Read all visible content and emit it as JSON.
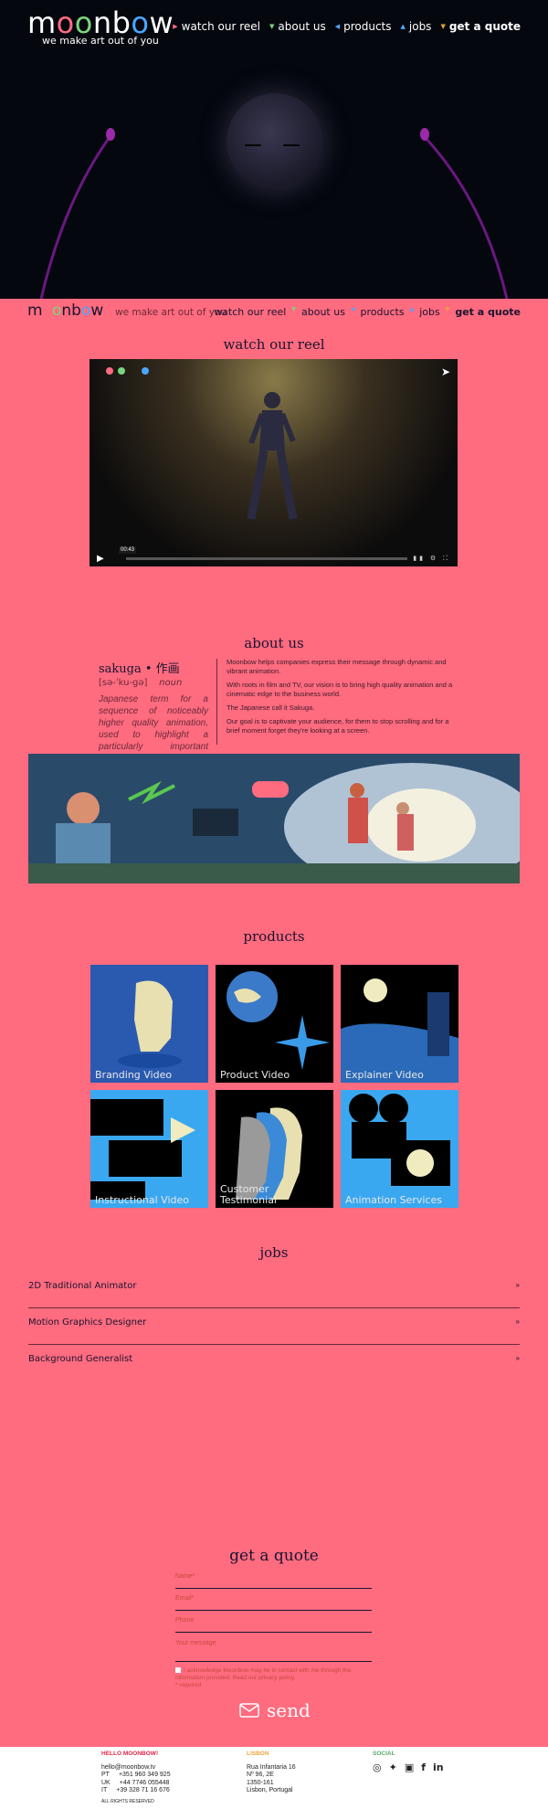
{
  "brand": {
    "logo_prefix": "m",
    "logo_o1": "o",
    "logo_o2": "o",
    "logo_mid": "nb",
    "logo_o3": "o",
    "logo_suffix": "w",
    "tagline": "we make art out of you"
  },
  "nav": {
    "reel": "watch our reel",
    "about": "about us",
    "products": "products",
    "jobs": "jobs",
    "quote": "get a quote"
  },
  "sections": {
    "reel_title": "watch our reel",
    "about_title": "about us",
    "products_title": "products",
    "jobs_title": "jobs",
    "quote_title": "get a quote"
  },
  "video": {
    "timestamp": "00:43"
  },
  "about": {
    "word": "sakuga • 作画",
    "phonetic": "[sə-ˈku-gə]",
    "pos": "noun",
    "definition": "Japanese term for a sequence of noticeably higher quality animation, used to highlight a particularly important scene.",
    "p1": "Moonbow helps companies express their message through dynamic and vibrant animation.",
    "p2": "With roots in film and TV, our vision is to bring high quality animation and a cinematic edge to the business world.",
    "p3": "The Japanese call it Sakuga.",
    "p4": "Our goal is to captivate your audience, for them to stop scrolling and for a brief moment forget they're looking at a screen."
  },
  "products": [
    {
      "label1": "Branding Video",
      "label2": ""
    },
    {
      "label1": "Product Video",
      "label2": ""
    },
    {
      "label1": "Explainer Video",
      "label2": ""
    },
    {
      "label1": "Instructional Video",
      "label2": ""
    },
    {
      "label1": "Customer",
      "label2": "Testimonial"
    },
    {
      "label1": "Animation Services",
      "label2": ""
    }
  ],
  "jobs": [
    "2D Traditional Animator",
    "Motion Graphics Designer",
    "Background Generalist"
  ],
  "form": {
    "name": "Name*",
    "email": "Email*",
    "phone": "Phone",
    "message": "Your message",
    "consent": "I acknowledge Moonbow may be in contact with me through the information provided. Read our privacy policy.",
    "required": "* required",
    "send": "send"
  },
  "footer": {
    "hello_title": "HELLO MOONBOW!",
    "email": "hello@moonbow.tv",
    "phones": [
      {
        "cc": "PT",
        "num": "+351 960 349 925"
      },
      {
        "cc": "UK",
        "num": "+44 7746 055448"
      },
      {
        "cc": "IT",
        "num": "+39 328 71 16 676"
      }
    ],
    "rights": "ALL RIGHTS RESERVED",
    "lisbon_title": "LISBON",
    "addr1": "Rua Infantaria 16",
    "addr2": "Nº 96, 2E",
    "addr3": "1350-161",
    "addr4": "Lisbon, Portugal",
    "social_title": "SOCIAL"
  },
  "colors": {
    "bg": "#ff6b7f",
    "hero": "#05070f",
    "dot_pink": "#ff6b7f",
    "dot_green": "#7bd67b",
    "dot_blue": "#4aa8ff",
    "lisbon_accent": "#e8a43a",
    "social_accent": "#5aa86a",
    "hello_accent": "#e0284a"
  }
}
